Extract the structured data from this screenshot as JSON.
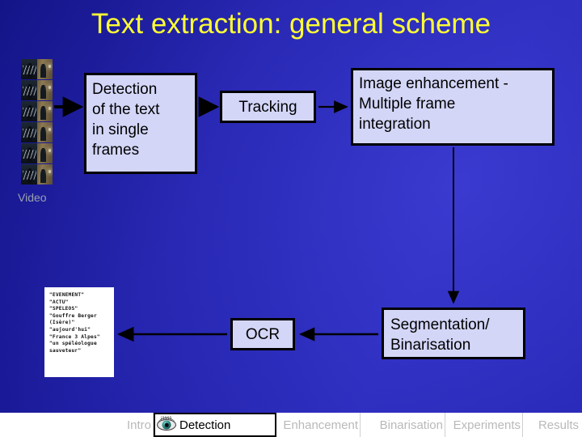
{
  "slide": {
    "title": "Text extraction: general scheme",
    "title_color": "#ffff33",
    "background_color": "#2626b4"
  },
  "diagram": {
    "video_label": "Video",
    "video_frame_count": 6,
    "boxes": {
      "detection": "Detection of the text in single frames",
      "detection_lines": [
        "Detection",
        "of the text",
        "in single",
        "frames"
      ],
      "tracking": "Tracking",
      "enhancement": "Image enhancement - Multiple frame integration",
      "enhancement_lines": [
        "Image enhancement -",
        "Multiple frame",
        "integration"
      ],
      "segmentation": "Segmentation/ Binarisation",
      "segmentation_lines": [
        "Segmentation/",
        "Binarisation"
      ],
      "ocr": "OCR"
    },
    "box_fill": "#d3d6f7",
    "box_border": "#000000",
    "result_lines": [
      "\"EVENEMENT\"",
      "\"ACTU\"",
      "\"SPELEOS\"",
      "\"Gouffre Berger",
      "(Isère)\"",
      "\"aujourd'hui\"",
      "\"France 3 Alpes\"",
      "\"un spéléologue",
      "sauveteur\""
    ]
  },
  "navbar": {
    "items": [
      {
        "label": "Intro",
        "active": false
      },
      {
        "label": "Detection",
        "active": true,
        "icon": "eye-icon"
      },
      {
        "label": "Enhancement",
        "active": false
      },
      {
        "label": "Binarisation",
        "active": false
      },
      {
        "label": "Experiments",
        "active": false
      },
      {
        "label": "Results",
        "active": false
      }
    ],
    "active_color": "#000000",
    "inactive_color": "#b9b9b9"
  }
}
